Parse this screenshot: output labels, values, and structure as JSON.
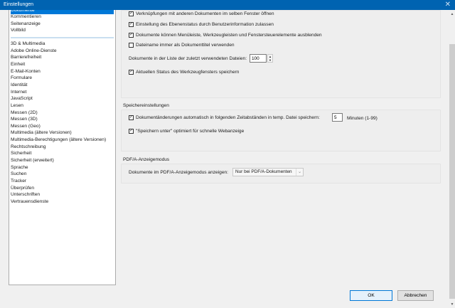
{
  "window": {
    "title": "Einstellungen",
    "close_icon": "close-icon"
  },
  "categories": {
    "selected": "Dokumente",
    "group1": [
      "Kommentieren",
      "Seitenanzeige",
      "Vollbild"
    ],
    "group2": [
      "3D & Multimedia",
      "Adobe Online-Dienste",
      "Barrierefreiheit",
      "Einheit",
      "E-Mail-Konten",
      "Formulare",
      "Identität",
      "Internet",
      "JavaScript",
      "Lesen",
      "Messen (2D)",
      "Messen (3D)",
      "Messen (Geo)",
      "Multimedia (ältere Versionen)",
      "Multimedia-Berechtigungen (ältere Versionen)",
      "Rechtschreibung",
      "Sicherheit",
      "Sicherheit (erweitert)",
      "Sprache",
      "Suchen",
      "Tracker",
      "Überprüfen",
      "Unterschriften",
      "Vertrauensdienste"
    ]
  },
  "open_settings": {
    "link_same_window": {
      "label": "Verknüpfungen mit anderen Dokumenten im selben Fenster öffnen",
      "checked": true
    },
    "layer_state": {
      "label": "Einstellung des Ebenenstatus durch Benutzerinformation zulassen",
      "checked": true
    },
    "hide_toolbars": {
      "label": "Dokumente können Menüleiste, Werkzeugleisten und Fenstersteuerelemente ausblenden",
      "checked": true
    },
    "filename_title": {
      "label": "Dateiname immer als Dokumenttitel verwenden",
      "checked": false
    },
    "recent_files": {
      "label": "Dokumente in der Liste der zuletzt verwendeten Dateien:",
      "value": "100"
    },
    "tool_window_state": {
      "label": "Aktuellen Status des Werkzeugfensters speichern",
      "checked": true
    }
  },
  "save_settings": {
    "title": "Speichereinstellungen",
    "autosave": {
      "label": "Dokumentänderungen automatisch in folgenden Zeitabständen in temp. Datei speichern:",
      "value": "5",
      "unit": "Minuten (1-99)",
      "checked": true
    },
    "fast_web": {
      "label": "\"Speichern unter\" optimiert für schnelle Webanzeige",
      "checked": true
    }
  },
  "pdfa": {
    "title": "PDF/A-Anzeigemodus",
    "label": "Dokumente im PDF/A-Anzeigemodus anzeigen:",
    "value": "Nur bei PDF/A-Dokumenten"
  },
  "buttons": {
    "ok": "OK",
    "cancel": "Abbrechen"
  },
  "colors": {
    "titlebar": "#0063b1",
    "selection": "#0078d7"
  }
}
